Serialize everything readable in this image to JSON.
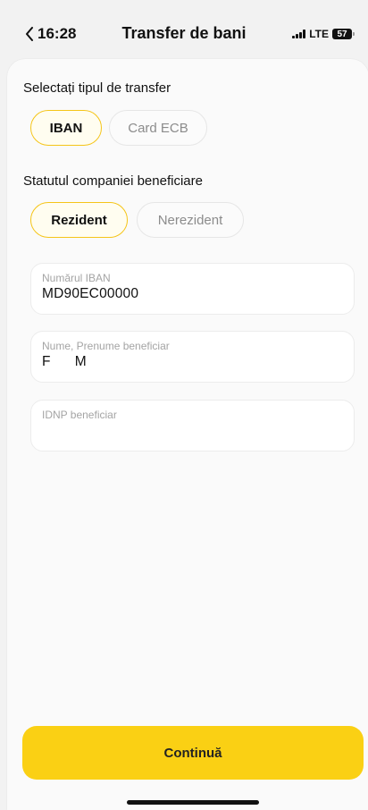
{
  "status_bar": {
    "time": "16:28",
    "network": "LTE",
    "battery": "57"
  },
  "header": {
    "title": "Transfer de bani",
    "back_icon": "chevron-left-icon"
  },
  "transfer_type": {
    "label": "Selectați tipul de transfer",
    "options": [
      "IBAN",
      "Card ECB"
    ],
    "selected": "IBAN"
  },
  "company_status": {
    "label": "Statutul companiei beneficiare",
    "options": [
      "Rezident",
      "Nerezident"
    ],
    "selected": "Rezident"
  },
  "fields": {
    "iban": {
      "label": "Numărul IBAN",
      "value": "MD90EC00000"
    },
    "name": {
      "label": "Nume, Prenume beneficiar",
      "value": "F      M"
    },
    "idnp": {
      "label": "IDNP beneficiar",
      "value": ""
    }
  },
  "footer": {
    "continue_label": "Continuă"
  },
  "colors": {
    "accent": "#fad014",
    "selected_border": "#f5c518",
    "background": "#f2f2f2"
  }
}
